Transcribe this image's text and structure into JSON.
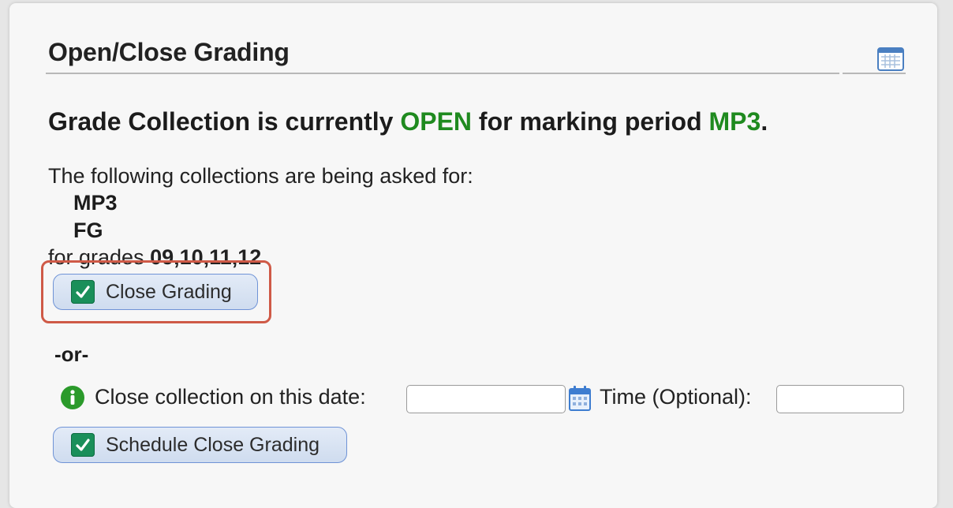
{
  "panel": {
    "title": "Open/Close Grading",
    "calendar_icon": "calendar-grid-icon"
  },
  "status": {
    "prefix": "Grade Collection is currently ",
    "state": "OPEN",
    "middle": " for marking period ",
    "period": "MP3",
    "suffix": "."
  },
  "collections": {
    "intro": "The following collections are being asked for:",
    "items": [
      "MP3",
      "FG"
    ],
    "grades_prefix": "for grades ",
    "grades_value": "09,10,11,12"
  },
  "close_button": {
    "label": "Close Grading",
    "icon": "checkbox-checked-icon"
  },
  "or_text": "-or-",
  "schedule": {
    "date_label": "Close collection on this date:",
    "date_value": "",
    "time_label": "Time (Optional):",
    "time_value": "",
    "button_label": "Schedule Close Grading",
    "info_icon": "info-icon",
    "calendar_icon": "calendar-picker-icon"
  },
  "colors": {
    "accent_green": "#1f8a1f",
    "button_border": "#6f93d6",
    "highlight": "#cf5a47",
    "check_green": "#1a8f5a"
  }
}
